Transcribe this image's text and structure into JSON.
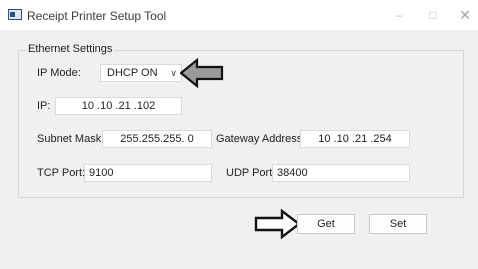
{
  "window": {
    "title": "Receipt Printer Setup Tool",
    "minimize_icon": "minimize-icon",
    "maximize_icon": "maximize-icon",
    "close_icon": "close-icon"
  },
  "ethernet": {
    "group_title": "Ethernet Settings",
    "ip_mode_label": "IP Mode:",
    "ip_mode_value": "DHCP ON",
    "ip_label": "IP:",
    "ip_value": "10 .10 .21 .102",
    "subnet_label": "Subnet Mask:",
    "subnet_value": "255.255.255. 0",
    "gateway_label": "Gateway Address:",
    "gateway_value": "10 .10 .21 .254",
    "tcp_label": "TCP Port:",
    "tcp_value": "9100",
    "udp_label": "UDP Port:",
    "udp_value": "38400"
  },
  "actions": {
    "get_label": "Get",
    "set_label": "Set"
  },
  "annotations": {
    "arrow_icon": "arrow-pointer-icon"
  }
}
